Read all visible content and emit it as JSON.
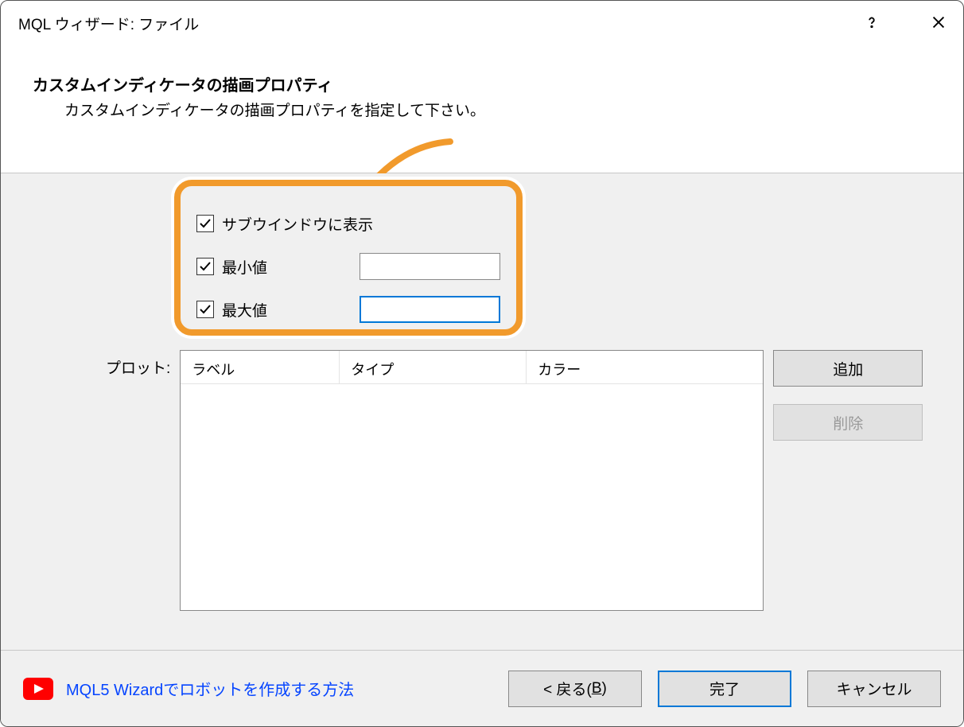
{
  "titlebar": {
    "title": "MQL ウィザード: ファイル"
  },
  "header": {
    "title": "カスタムインディケータの描画プロパティ",
    "description": "カスタムインディケータの描画プロパティを指定して下さい。"
  },
  "options": {
    "subwindow_label": "サブウインドウに表示",
    "min_label": "最小値",
    "max_label": "最大値",
    "min_value": "",
    "max_value": ""
  },
  "plot": {
    "label": "プロット:",
    "columns": {
      "c1": "ラベル",
      "c2": "タイプ",
      "c3": "カラー"
    }
  },
  "buttons": {
    "add": "追加",
    "delete": "削除",
    "back_prefix": "< 戻る(",
    "back_key": "B",
    "back_suffix": ")",
    "finish": "完了",
    "cancel": "キャンセル"
  },
  "footer": {
    "link": "MQL5 Wizardでロボットを作成する方法"
  }
}
